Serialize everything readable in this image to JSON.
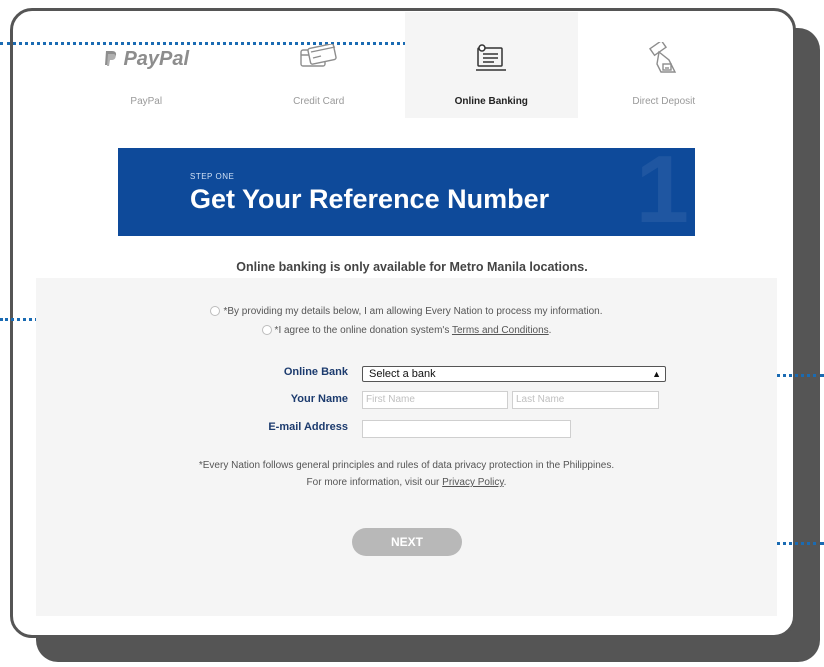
{
  "tabs": [
    {
      "label": "PayPal",
      "icon": "paypal-logo-icon",
      "logo_text": "PayPal"
    },
    {
      "label": "Credit Card",
      "icon": "credit-card-icon"
    },
    {
      "label": "Online Banking",
      "icon": "online-banking-icon"
    },
    {
      "label": "Direct Deposit",
      "icon": "direct-deposit-icon"
    }
  ],
  "banner": {
    "step": "STEP ONE",
    "title": "Get Your Reference Number",
    "number": "1"
  },
  "notice": "Online banking is only available for Metro Manila locations.",
  "consent": {
    "privacy_text": "*By providing my details below, I am allowing Every Nation to process my information.",
    "terms_prefix": "*I agree to the online donation system's ",
    "terms_link": "Terms and Conditions",
    "terms_suffix": "."
  },
  "form": {
    "bank_label": "Online Bank",
    "bank_value": "Select a bank",
    "name_label": "Your Name",
    "first_name_placeholder": "First Name",
    "last_name_placeholder": "Last Name",
    "email_label": "E-mail Address",
    "email_value": ""
  },
  "privacy_note": {
    "line1": "*Every Nation follows general principles and rules of data privacy protection in the Philippines.",
    "line2_prefix": "For more information, visit our ",
    "line2_link": "Privacy Policy",
    "line2_suffix": "."
  },
  "next_label": "NEXT",
  "colors": {
    "brand_blue": "#0e4a9a",
    "dots": "#1a6bb3",
    "frame": "#555555",
    "button": "#b8b8b8"
  }
}
